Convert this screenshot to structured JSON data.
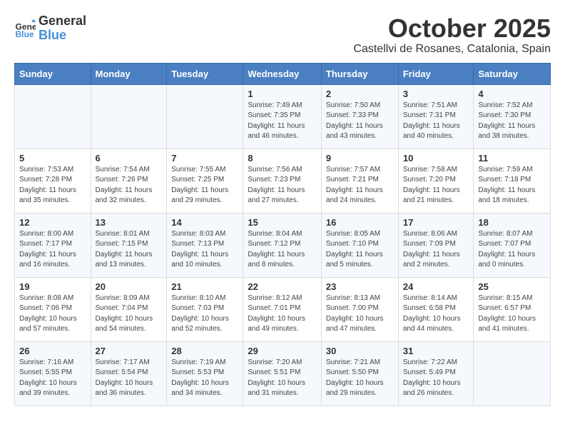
{
  "header": {
    "logo_line1": "General",
    "logo_line2": "Blue",
    "month": "October 2025",
    "location": "Castellvi de Rosanes, Catalonia, Spain"
  },
  "weekdays": [
    "Sunday",
    "Monday",
    "Tuesday",
    "Wednesday",
    "Thursday",
    "Friday",
    "Saturday"
  ],
  "weeks": [
    [
      {
        "day": "",
        "info": ""
      },
      {
        "day": "",
        "info": ""
      },
      {
        "day": "",
        "info": ""
      },
      {
        "day": "1",
        "info": "Sunrise: 7:49 AM\nSunset: 7:35 PM\nDaylight: 11 hours\nand 46 minutes."
      },
      {
        "day": "2",
        "info": "Sunrise: 7:50 AM\nSunset: 7:33 PM\nDaylight: 11 hours\nand 43 minutes."
      },
      {
        "day": "3",
        "info": "Sunrise: 7:51 AM\nSunset: 7:31 PM\nDaylight: 11 hours\nand 40 minutes."
      },
      {
        "day": "4",
        "info": "Sunrise: 7:52 AM\nSunset: 7:30 PM\nDaylight: 11 hours\nand 38 minutes."
      }
    ],
    [
      {
        "day": "5",
        "info": "Sunrise: 7:53 AM\nSunset: 7:28 PM\nDaylight: 11 hours\nand 35 minutes."
      },
      {
        "day": "6",
        "info": "Sunrise: 7:54 AM\nSunset: 7:26 PM\nDaylight: 11 hours\nand 32 minutes."
      },
      {
        "day": "7",
        "info": "Sunrise: 7:55 AM\nSunset: 7:25 PM\nDaylight: 11 hours\nand 29 minutes."
      },
      {
        "day": "8",
        "info": "Sunrise: 7:56 AM\nSunset: 7:23 PM\nDaylight: 11 hours\nand 27 minutes."
      },
      {
        "day": "9",
        "info": "Sunrise: 7:57 AM\nSunset: 7:21 PM\nDaylight: 11 hours\nand 24 minutes."
      },
      {
        "day": "10",
        "info": "Sunrise: 7:58 AM\nSunset: 7:20 PM\nDaylight: 11 hours\nand 21 minutes."
      },
      {
        "day": "11",
        "info": "Sunrise: 7:59 AM\nSunset: 7:18 PM\nDaylight: 11 hours\nand 18 minutes."
      }
    ],
    [
      {
        "day": "12",
        "info": "Sunrise: 8:00 AM\nSunset: 7:17 PM\nDaylight: 11 hours\nand 16 minutes."
      },
      {
        "day": "13",
        "info": "Sunrise: 8:01 AM\nSunset: 7:15 PM\nDaylight: 11 hours\nand 13 minutes."
      },
      {
        "day": "14",
        "info": "Sunrise: 8:03 AM\nSunset: 7:13 PM\nDaylight: 11 hours\nand 10 minutes."
      },
      {
        "day": "15",
        "info": "Sunrise: 8:04 AM\nSunset: 7:12 PM\nDaylight: 11 hours\nand 8 minutes."
      },
      {
        "day": "16",
        "info": "Sunrise: 8:05 AM\nSunset: 7:10 PM\nDaylight: 11 hours\nand 5 minutes."
      },
      {
        "day": "17",
        "info": "Sunrise: 8:06 AM\nSunset: 7:09 PM\nDaylight: 11 hours\nand 2 minutes."
      },
      {
        "day": "18",
        "info": "Sunrise: 8:07 AM\nSunset: 7:07 PM\nDaylight: 11 hours\nand 0 minutes."
      }
    ],
    [
      {
        "day": "19",
        "info": "Sunrise: 8:08 AM\nSunset: 7:06 PM\nDaylight: 10 hours\nand 57 minutes."
      },
      {
        "day": "20",
        "info": "Sunrise: 8:09 AM\nSunset: 7:04 PM\nDaylight: 10 hours\nand 54 minutes."
      },
      {
        "day": "21",
        "info": "Sunrise: 8:10 AM\nSunset: 7:03 PM\nDaylight: 10 hours\nand 52 minutes."
      },
      {
        "day": "22",
        "info": "Sunrise: 8:12 AM\nSunset: 7:01 PM\nDaylight: 10 hours\nand 49 minutes."
      },
      {
        "day": "23",
        "info": "Sunrise: 8:13 AM\nSunset: 7:00 PM\nDaylight: 10 hours\nand 47 minutes."
      },
      {
        "day": "24",
        "info": "Sunrise: 8:14 AM\nSunset: 6:58 PM\nDaylight: 10 hours\nand 44 minutes."
      },
      {
        "day": "25",
        "info": "Sunrise: 8:15 AM\nSunset: 6:57 PM\nDaylight: 10 hours\nand 41 minutes."
      }
    ],
    [
      {
        "day": "26",
        "info": "Sunrise: 7:16 AM\nSunset: 5:55 PM\nDaylight: 10 hours\nand 39 minutes."
      },
      {
        "day": "27",
        "info": "Sunrise: 7:17 AM\nSunset: 5:54 PM\nDaylight: 10 hours\nand 36 minutes."
      },
      {
        "day": "28",
        "info": "Sunrise: 7:19 AM\nSunset: 5:53 PM\nDaylight: 10 hours\nand 34 minutes."
      },
      {
        "day": "29",
        "info": "Sunrise: 7:20 AM\nSunset: 5:51 PM\nDaylight: 10 hours\nand 31 minutes."
      },
      {
        "day": "30",
        "info": "Sunrise: 7:21 AM\nSunset: 5:50 PM\nDaylight: 10 hours\nand 29 minutes."
      },
      {
        "day": "31",
        "info": "Sunrise: 7:22 AM\nSunset: 5:49 PM\nDaylight: 10 hours\nand 26 minutes."
      },
      {
        "day": "",
        "info": ""
      }
    ]
  ]
}
